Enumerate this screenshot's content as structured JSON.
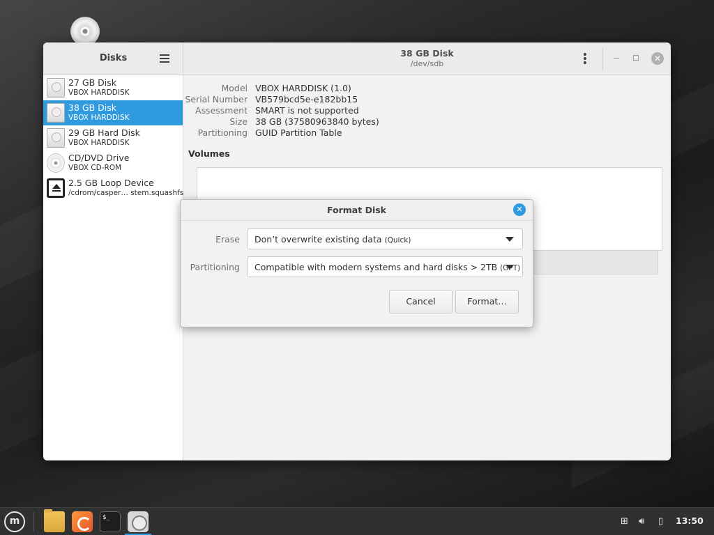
{
  "sidebar": {
    "title": "Disks",
    "items": [
      {
        "name": "27 GB Disk",
        "sub": "VBOX HARDDISK",
        "icon": "hard-disk-icon"
      },
      {
        "name": "38 GB Disk",
        "sub": "VBOX HARDDISK",
        "icon": "hard-disk-icon",
        "selected": true
      },
      {
        "name": "29 GB Hard Disk",
        "sub": "VBOX HARDDISK",
        "icon": "hard-disk-icon"
      },
      {
        "name": "CD/DVD Drive",
        "sub": "VBOX CD-ROM",
        "icon": "optical-disc-icon"
      },
      {
        "name": "2.5 GB Loop Device",
        "sub": "/cdrom/casper… stem.squashfs",
        "icon": "eject-icon"
      }
    ]
  },
  "header": {
    "title": "38 GB Disk",
    "subtitle": "/dev/sdb"
  },
  "properties": [
    {
      "label": "Model",
      "value": "VBOX HARDDISK (1.0)"
    },
    {
      "label": "Serial Number",
      "value": "VB579bcd5e-e182bb15"
    },
    {
      "label": "Assessment",
      "value": "SMART is not supported"
    },
    {
      "label": "Size",
      "value": "38 GB (37580963840 bytes)"
    },
    {
      "label": "Partitioning",
      "value": "GUID Partition Table"
    }
  ],
  "volumes_label": "Volumes",
  "dialog": {
    "title": "Format Disk",
    "erase_label": "Erase",
    "erase_value": "Don’t overwrite existing data",
    "erase_hint": "(Quick)",
    "partitioning_label": "Partitioning",
    "partitioning_value": "Compatible with modern systems and hard disks > 2TB",
    "partitioning_hint": "(GPT)",
    "cancel_label": "Cancel",
    "format_label": "Format…"
  },
  "taskbar": {
    "clock": "13:50",
    "terminal_glyph": "$_",
    "apps": [
      "folder-icon",
      "firefox-icon",
      "terminal-icon",
      "disks-icon"
    ]
  },
  "colors": {
    "accent": "#2f9ade",
    "window_bg": "#f2f2f2",
    "taskbar_bg": "#303030"
  }
}
